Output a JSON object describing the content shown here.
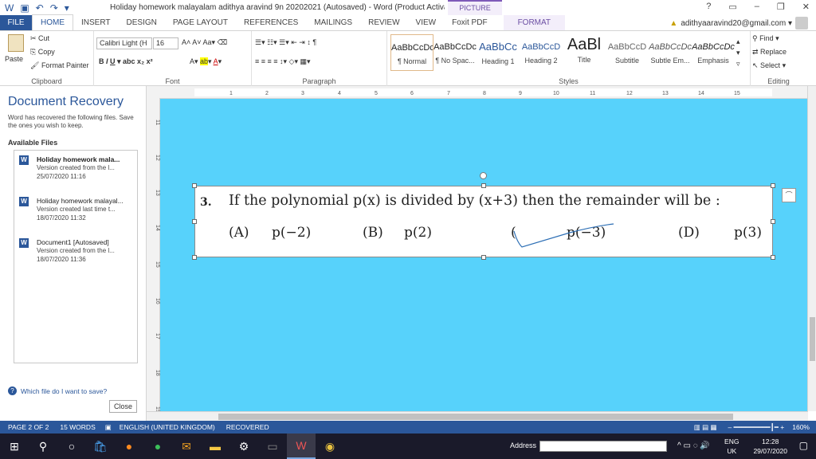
{
  "titlebar": {
    "title": "Holiday homework malayalam adithya aravind 9n 20202021 (Autosaved) - Word (Product Activation Fa...",
    "picture_tools": "PICTURE TOOLS",
    "help": "?",
    "minimize": "–",
    "restore": "❐",
    "close": "✕"
  },
  "tabs": [
    "FILE",
    "HOME",
    "INSERT",
    "DESIGN",
    "PAGE LAYOUT",
    "REFERENCES",
    "MAILINGS",
    "REVIEW",
    "VIEW",
    "Foxit PDF",
    "FORMAT"
  ],
  "account": {
    "email": "adithyaaravind20@gmail.com ▾"
  },
  "ribbon": {
    "clipboard": {
      "paste": "Paste",
      "cut": "Cut",
      "copy": "Copy",
      "format_painter": "Format Painter",
      "label": "Clipboard"
    },
    "font": {
      "family": "Calibri Light (H",
      "size": "16",
      "label": "Font"
    },
    "paragraph": {
      "label": "Paragraph"
    },
    "styles": {
      "label": "Styles",
      "items": [
        {
          "preview": "AaBbCcDc",
          "name": "¶ Normal"
        },
        {
          "preview": "AaBbCcDc",
          "name": "¶ No Spac..."
        },
        {
          "preview": "AaBbCc",
          "name": "Heading 1"
        },
        {
          "preview": "AaBbCcD",
          "name": "Heading 2"
        },
        {
          "preview": "AaBl",
          "name": "Title"
        },
        {
          "preview": "AaBbCcD",
          "name": "Subtitle"
        },
        {
          "preview": "AaBbCcDc",
          "name": "Subtle Em..."
        },
        {
          "preview": "AaBbCcDc",
          "name": "Emphasis"
        }
      ]
    },
    "editing": {
      "find": "Find",
      "replace": "Replace",
      "select": "Select",
      "label": "Editing"
    }
  },
  "recovery": {
    "title": "Document Recovery",
    "desc": "Word has recovered the following files. Save the ones you wish to keep.",
    "available": "Available Files",
    "files": [
      {
        "title": "Holiday homework mala...",
        "version": "Version created from the l...",
        "date": "25/07/2020 11:16"
      },
      {
        "title": "Holiday homework malayal...",
        "version": "Version created last time t...",
        "date": "18/07/2020 11:32"
      },
      {
        "title": "Document1  [Autosaved]",
        "version": "Version created from the l...",
        "date": "18/07/2020 11:36"
      }
    ],
    "help": "Which file do I want to save?",
    "close": "Close"
  },
  "ruler": {
    "h_ticks": [
      "1",
      "2",
      "3",
      "4",
      "5",
      "6",
      "7",
      "8",
      "9",
      "10",
      "11",
      "12",
      "13",
      "14",
      "15"
    ],
    "v_ticks": [
      "11",
      "12",
      "13",
      "14",
      "15",
      "16",
      "17",
      "18",
      "19"
    ]
  },
  "question": {
    "number": "3.",
    "text": "If the polynomial p(x) is divided by (x+3) then the remainder will be :",
    "options": [
      {
        "label": "(A)",
        "value": "p(−2)"
      },
      {
        "label": "(B)",
        "value": "p(2)"
      },
      {
        "label": "(",
        "value": "p(−3)"
      },
      {
        "label": "(D)",
        "value": "p(3)"
      }
    ]
  },
  "status": {
    "page": "PAGE 2 OF 2",
    "words": "15 WORDS",
    "language": "ENGLISH (UNITED KINGDOM)",
    "state": "RECOVERED",
    "zoom": "160%"
  },
  "taskbar": {
    "address_label": "Address",
    "lang": "ENG",
    "region": "UK",
    "time": "12:28",
    "date": "29/07/2020"
  },
  "colors": {
    "accent": "#2b579a",
    "canvas": "#57d2fb",
    "format_tab": "#6b4ea3"
  }
}
